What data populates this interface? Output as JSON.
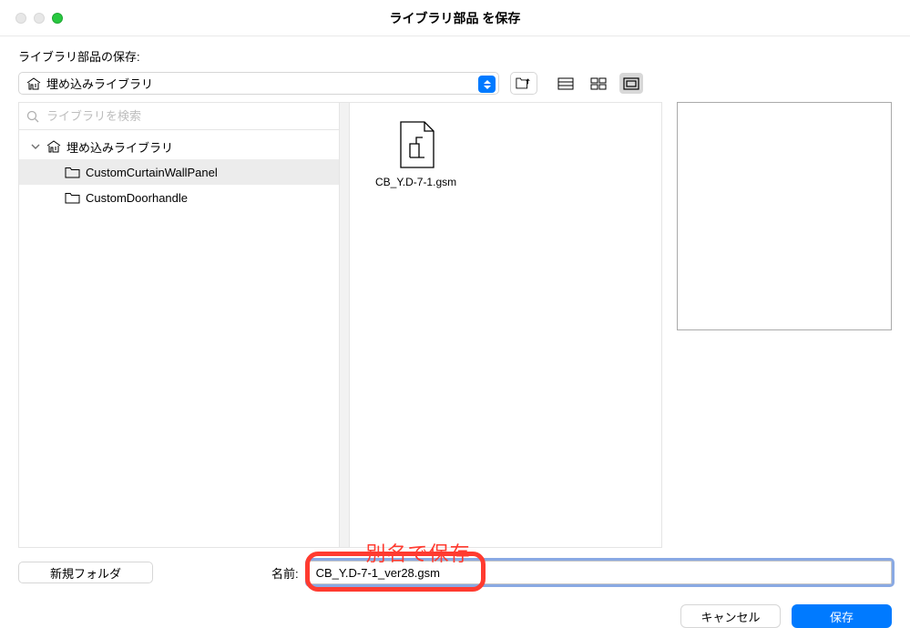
{
  "window": {
    "title": "ライブラリ部品 を保存"
  },
  "toolbar": {
    "label": "ライブラリ部品の保存:",
    "selected_library": "埋め込みライブラリ"
  },
  "search": {
    "placeholder": "ライブラリを検索"
  },
  "tree": {
    "root": "埋め込みライブラリ",
    "items": [
      {
        "label": "CustomCurtainWallPanel",
        "selected": true
      },
      {
        "label": "CustomDoorhandle",
        "selected": false
      }
    ]
  },
  "files": {
    "list": [
      {
        "name": "CB_Y.D-7-1.gsm"
      }
    ]
  },
  "annotation": "別名で保存",
  "name_row": {
    "new_folder": "新規フォルダ",
    "label": "名前:",
    "value": "CB_Y.D-7-1_ver28.gsm"
  },
  "footer": {
    "cancel": "キャンセル",
    "save": "保存"
  }
}
